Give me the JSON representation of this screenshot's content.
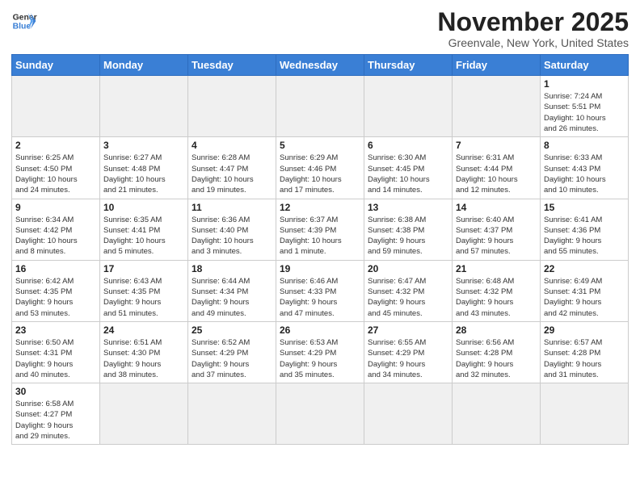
{
  "header": {
    "logo_general": "General",
    "logo_blue": "Blue",
    "title": "November 2025",
    "location": "Greenvale, New York, United States"
  },
  "days_of_week": [
    "Sunday",
    "Monday",
    "Tuesday",
    "Wednesday",
    "Thursday",
    "Friday",
    "Saturday"
  ],
  "weeks": [
    [
      {
        "day": "",
        "info": "",
        "empty": true
      },
      {
        "day": "",
        "info": "",
        "empty": true
      },
      {
        "day": "",
        "info": "",
        "empty": true
      },
      {
        "day": "",
        "info": "",
        "empty": true
      },
      {
        "day": "",
        "info": "",
        "empty": true
      },
      {
        "day": "",
        "info": "",
        "empty": true
      },
      {
        "day": "1",
        "info": "Sunrise: 7:24 AM\nSunset: 5:51 PM\nDaylight: 10 hours\nand 26 minutes."
      }
    ],
    [
      {
        "day": "2",
        "info": "Sunrise: 6:25 AM\nSunset: 4:50 PM\nDaylight: 10 hours\nand 24 minutes."
      },
      {
        "day": "3",
        "info": "Sunrise: 6:27 AM\nSunset: 4:48 PM\nDaylight: 10 hours\nand 21 minutes."
      },
      {
        "day": "4",
        "info": "Sunrise: 6:28 AM\nSunset: 4:47 PM\nDaylight: 10 hours\nand 19 minutes."
      },
      {
        "day": "5",
        "info": "Sunrise: 6:29 AM\nSunset: 4:46 PM\nDaylight: 10 hours\nand 17 minutes."
      },
      {
        "day": "6",
        "info": "Sunrise: 6:30 AM\nSunset: 4:45 PM\nDaylight: 10 hours\nand 14 minutes."
      },
      {
        "day": "7",
        "info": "Sunrise: 6:31 AM\nSunset: 4:44 PM\nDaylight: 10 hours\nand 12 minutes."
      },
      {
        "day": "8",
        "info": "Sunrise: 6:33 AM\nSunset: 4:43 PM\nDaylight: 10 hours\nand 10 minutes."
      }
    ],
    [
      {
        "day": "9",
        "info": "Sunrise: 6:34 AM\nSunset: 4:42 PM\nDaylight: 10 hours\nand 8 minutes."
      },
      {
        "day": "10",
        "info": "Sunrise: 6:35 AM\nSunset: 4:41 PM\nDaylight: 10 hours\nand 5 minutes."
      },
      {
        "day": "11",
        "info": "Sunrise: 6:36 AM\nSunset: 4:40 PM\nDaylight: 10 hours\nand 3 minutes."
      },
      {
        "day": "12",
        "info": "Sunrise: 6:37 AM\nSunset: 4:39 PM\nDaylight: 10 hours\nand 1 minute."
      },
      {
        "day": "13",
        "info": "Sunrise: 6:38 AM\nSunset: 4:38 PM\nDaylight: 9 hours\nand 59 minutes."
      },
      {
        "day": "14",
        "info": "Sunrise: 6:40 AM\nSunset: 4:37 PM\nDaylight: 9 hours\nand 57 minutes."
      },
      {
        "day": "15",
        "info": "Sunrise: 6:41 AM\nSunset: 4:36 PM\nDaylight: 9 hours\nand 55 minutes."
      }
    ],
    [
      {
        "day": "16",
        "info": "Sunrise: 6:42 AM\nSunset: 4:35 PM\nDaylight: 9 hours\nand 53 minutes."
      },
      {
        "day": "17",
        "info": "Sunrise: 6:43 AM\nSunset: 4:35 PM\nDaylight: 9 hours\nand 51 minutes."
      },
      {
        "day": "18",
        "info": "Sunrise: 6:44 AM\nSunset: 4:34 PM\nDaylight: 9 hours\nand 49 minutes."
      },
      {
        "day": "19",
        "info": "Sunrise: 6:46 AM\nSunset: 4:33 PM\nDaylight: 9 hours\nand 47 minutes."
      },
      {
        "day": "20",
        "info": "Sunrise: 6:47 AM\nSunset: 4:32 PM\nDaylight: 9 hours\nand 45 minutes."
      },
      {
        "day": "21",
        "info": "Sunrise: 6:48 AM\nSunset: 4:32 PM\nDaylight: 9 hours\nand 43 minutes."
      },
      {
        "day": "22",
        "info": "Sunrise: 6:49 AM\nSunset: 4:31 PM\nDaylight: 9 hours\nand 42 minutes."
      }
    ],
    [
      {
        "day": "23",
        "info": "Sunrise: 6:50 AM\nSunset: 4:31 PM\nDaylight: 9 hours\nand 40 minutes."
      },
      {
        "day": "24",
        "info": "Sunrise: 6:51 AM\nSunset: 4:30 PM\nDaylight: 9 hours\nand 38 minutes."
      },
      {
        "day": "25",
        "info": "Sunrise: 6:52 AM\nSunset: 4:29 PM\nDaylight: 9 hours\nand 37 minutes."
      },
      {
        "day": "26",
        "info": "Sunrise: 6:53 AM\nSunset: 4:29 PM\nDaylight: 9 hours\nand 35 minutes."
      },
      {
        "day": "27",
        "info": "Sunrise: 6:55 AM\nSunset: 4:29 PM\nDaylight: 9 hours\nand 34 minutes."
      },
      {
        "day": "28",
        "info": "Sunrise: 6:56 AM\nSunset: 4:28 PM\nDaylight: 9 hours\nand 32 minutes."
      },
      {
        "day": "29",
        "info": "Sunrise: 6:57 AM\nSunset: 4:28 PM\nDaylight: 9 hours\nand 31 minutes."
      }
    ],
    [
      {
        "day": "30",
        "info": "Sunrise: 6:58 AM\nSunset: 4:27 PM\nDaylight: 9 hours\nand 29 minutes."
      },
      {
        "day": "",
        "info": "",
        "empty": true
      },
      {
        "day": "",
        "info": "",
        "empty": true
      },
      {
        "day": "",
        "info": "",
        "empty": true
      },
      {
        "day": "",
        "info": "",
        "empty": true
      },
      {
        "day": "",
        "info": "",
        "empty": true
      },
      {
        "day": "",
        "info": "",
        "empty": true
      }
    ]
  ]
}
